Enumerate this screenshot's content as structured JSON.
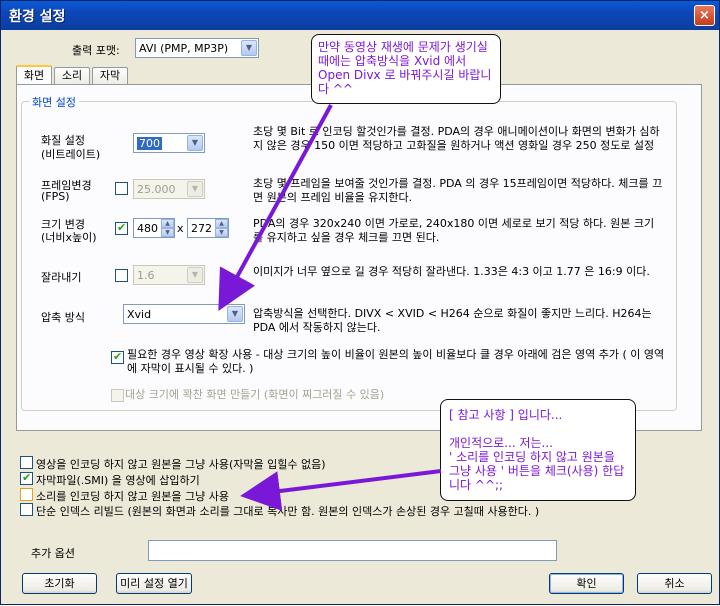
{
  "window": {
    "title": "환경 설정",
    "close_glyph": "×"
  },
  "output_format": {
    "label": "출력 포맷:",
    "value": "AVI (PMP, MP3P)"
  },
  "tabs": [
    "화면",
    "소리",
    "자막"
  ],
  "group": {
    "title": "화면 설정"
  },
  "quality": {
    "label_line1": "화질 설정",
    "label_line2": "(비트레이트)",
    "value": "700",
    "desc": "초당 몇 Bit 로 인코딩 할것인가를 결정. PDA의 경우 애니메이션이나 화면의 변화가 심하지 않은 경우 150 이면 적당하고 고화질을 원하거나 액션 영화일 경우 250 정도로 설정"
  },
  "framerate": {
    "label_line1": "프레임변경",
    "label_line2": "(FPS)",
    "value": "25.000",
    "desc": "초당 몇 프레임을 보여줄 것인가를 결정. PDA 의 경우 15프레임이면 적당하다. 체크를 끄면 원본의 프레임 비율을 유지한다."
  },
  "resize": {
    "label_line1": "크기 변경",
    "label_line2": "(너비x높이)",
    "width": "480",
    "x": "x",
    "height": "272",
    "desc": "PDA의 경우 320x240 이면 가로로, 240x180 이면 세로로 보기 적당 하다. 원본 크기를 유지하고 싶을 경우 체크를 끄면 된다."
  },
  "crop": {
    "label": "잘라내기",
    "value": "1.6",
    "desc": "이미지가 너무 옆으로 길 경우 적당히 잘라낸다. 1.33은 4:3 이고 1.77 은 16:9 이다."
  },
  "compression": {
    "label": "압축 방식",
    "value": "Xvid",
    "desc": "압축방식을 선택한다.  DIVX < XVID < H264 순으로 화질이 좋지만 느리다. H264는 PDA 에서 작동하지 않는다."
  },
  "expand_option": "필요한 경우 영상 확장 사용 - 대상 크기의 높이 비율이 원본의 높이 비율보다 클 경우 아래에 검은 영역 추가 ( 이 영역에 자막이 표시될 수 있다. )",
  "fit_option": "대상 크기에 꽉찬 화면 만들기 (화면이 찌그러질 수 있음)",
  "options": [
    {
      "label": "영상을 인코딩 하지 않고 원본을 그냥 사용(자막을 입힐수 없음)",
      "checked": false
    },
    {
      "label": "자막파일(.SMI) 을 영상에 삽입하기",
      "checked": true
    },
    {
      "label": "소리를 인코딩 하지 않고 원본을 그냥 사용",
      "checked": false
    },
    {
      "label": "단순 인덱스 리빌드 (원본의 화면과 소리를 그대로 복사만 함. 원본의 인덱스가 손상된 경우 고칠때 사용한다. )",
      "checked": false
    }
  ],
  "extra": {
    "label": "추가 옵션",
    "value": ""
  },
  "buttons": {
    "reset": "초기화",
    "presets": "미리 설정 열기",
    "ok": "확인",
    "cancel": "취소"
  },
  "callout_top": {
    "text": "만약 동영상 재생에 문제가 생기실때에는 압축방식을 Xvid 에서 Open Divx 로 바꿔주시길 바랍니다 ^^"
  },
  "callout_bottom": {
    "line1": "[ 참고 사항 ] 입니다...",
    "line2": "개인적으로... 저는...",
    "line3": "' 소리를 인코딩 하지 않고 원본을 그냥 사용 ' 버튼을 체크(사용) 한답니다 ^^;;"
  },
  "colors": {
    "titlebar": "#0a5bd6",
    "annotation": "#7a18d8",
    "dialog_bg": "#ece9d8"
  }
}
